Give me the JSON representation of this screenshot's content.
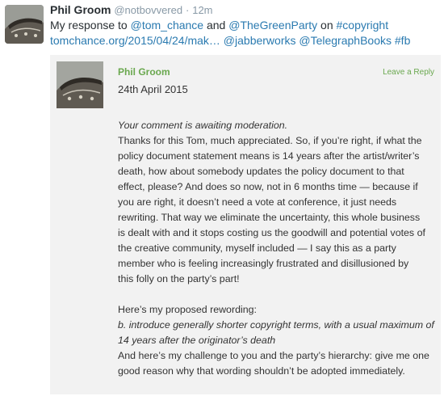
{
  "tweet": {
    "author_name": "Phil Groom",
    "handle": "@notbovvered",
    "separator": "·",
    "time": "12m",
    "line1_prefix": "My response to ",
    "mention1": "@tom_chance",
    "line1_and": " and ",
    "mention2": "@TheGreenParty",
    "line1_on": " on ",
    "hashtag1": "#copyright",
    "link_url": "tomchance.org/2015/04/24/mak…",
    "mention3": "@jabberworks",
    "mention4": "@TelegraphBooks",
    "hashtag2": "#fb"
  },
  "comment": {
    "author": "Phil Groom",
    "date": "24th April 2015",
    "reply_label": "Leave a Reply",
    "moderation_notice": "Your comment is awaiting moderation.",
    "paragraph1_lines": [
      "Thanks for this Tom, much appreciated. So, if you’re right, if what the",
      "policy document statement means is 14 years after the artist/writer’s",
      "death, how about somebody updates the policy document to that",
      "effect, please? And does so now, not in 6 months time — because if",
      "you are right, it doesn’t need a vote at conference, it just needs",
      "rewriting. That way we eliminate the uncertainty, this whole business",
      "is dealt with and it stops costing us the goodwill and potential votes of",
      "the creative community, myself included — I say this as a party",
      "member who is feeling increasingly frustrated and disillusioned by",
      "this folly on the party’s part!"
    ],
    "paragraph2_intro": "Here’s my proposed rewording:",
    "proposal_lines": [
      "b. introduce generally shorter copyright terms, with a usual maximum of",
      "14 years after the originator’s death"
    ],
    "challenge_lines": [
      "And here’s my challenge to you and the party’s hierarchy: give me one",
      "good reason why that wording shouldn’t be adopted immediately."
    ]
  },
  "colors": {
    "link_blue": "#2a7ab0",
    "comment_green": "#6aa84f",
    "card_background": "#f2f2f2",
    "muted_gray": "#8899a6"
  }
}
